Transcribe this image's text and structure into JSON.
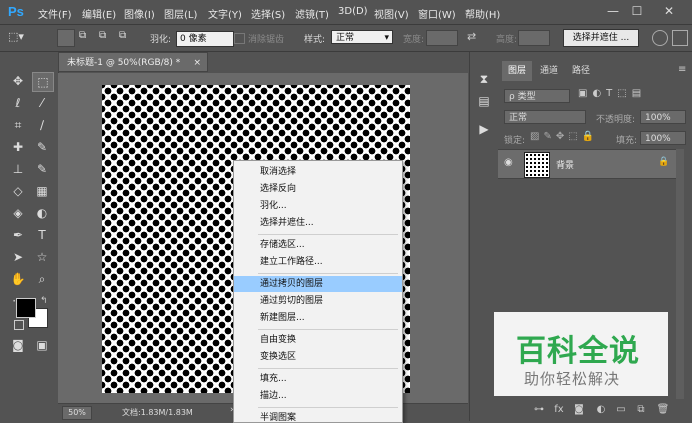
{
  "app": {
    "logo": "Ps"
  },
  "menubar": {
    "items": [
      "文件(F)",
      "编辑(E)",
      "图像(I)",
      "图层(L)",
      "文字(Y)",
      "选择(S)",
      "滤镜(T)",
      "3D(D)",
      "视图(V)",
      "窗口(W)",
      "帮助(H)"
    ],
    "min_icon": "minimize-icon",
    "max_icon": "maximize-icon",
    "close_icon": "close-icon"
  },
  "options": {
    "feather_label": "羽化:",
    "feather_value": "0 像素",
    "antialias_label": "消除锯齿",
    "style_label": "样式:",
    "style_value": "正常",
    "width_label": "宽度:",
    "height_label": "高度:",
    "select_mask_button": "选择并遮住 ..."
  },
  "document": {
    "tab_title": "未标题-1 @ 50%(RGB/8) *",
    "zoom": "50%",
    "doc_info": "文档:1.83M/1.83M"
  },
  "context_menu": {
    "items": [
      {
        "label": "取消选择",
        "active": false
      },
      {
        "label": "选择反向",
        "active": false
      },
      {
        "label": "羽化...",
        "active": false
      },
      {
        "label": "选择并遮住...",
        "active": false
      },
      {
        "label": "存储选区...",
        "active": false
      },
      {
        "label": "建立工作路径...",
        "active": false
      },
      {
        "label": "通过拷贝的图层",
        "active": true
      },
      {
        "label": "通过剪切的图层",
        "active": false
      },
      {
        "label": "新建图层...",
        "active": false
      },
      {
        "label": "自由变换",
        "active": false
      },
      {
        "label": "变换选区",
        "active": false
      },
      {
        "label": "填充...",
        "active": false
      },
      {
        "label": "描边...",
        "active": false
      },
      {
        "label": "半调图案",
        "active": false
      }
    ]
  },
  "layers_panel": {
    "tabs": [
      "图层",
      "通道",
      "路径"
    ],
    "filter_label": "ρ 类型",
    "blend_mode": "正常",
    "opacity_label": "不透明度:",
    "opacity_value": "100%",
    "lock_label": "锁定:",
    "fill_label": "填充:",
    "fill_value": "100%",
    "layer_name": "背景"
  },
  "watermark": {
    "title": "百科全说",
    "subtitle": "助你轻松解决",
    "title_color": "#2fa84f"
  },
  "colors": {
    "active_item": "#99ccff",
    "foreground": "#000000",
    "background": "#ffffff"
  }
}
